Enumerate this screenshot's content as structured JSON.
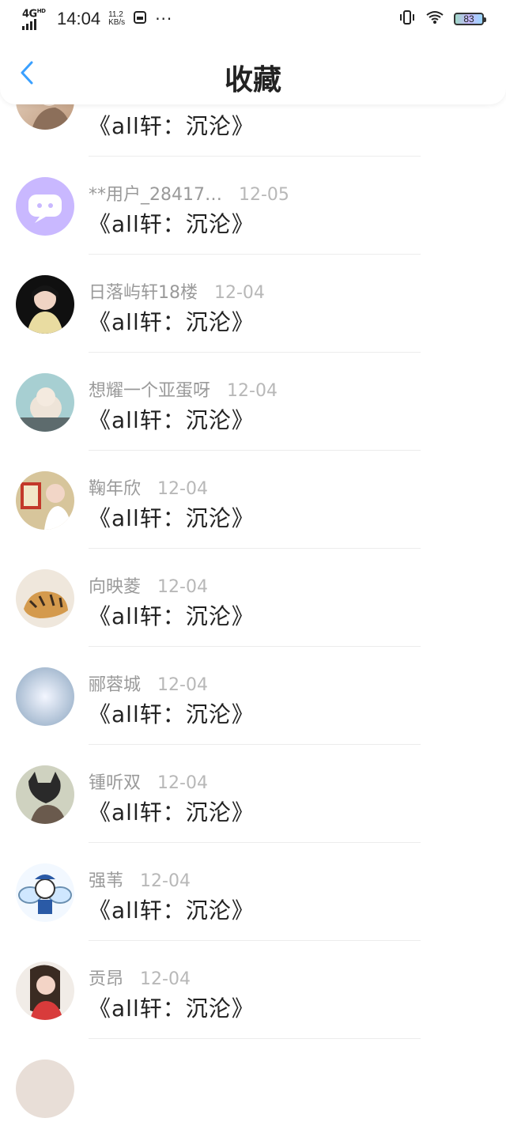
{
  "status_bar": {
    "network": "4G",
    "network_sup": "HD",
    "time": "14:04",
    "speed_value": "11.2",
    "speed_unit": "KB/s",
    "more": "···",
    "battery": "83"
  },
  "header": {
    "title": "收藏"
  },
  "list": {
    "items": [
      {
        "user": "",
        "time": "",
        "work": "《all轩：沉沦》"
      },
      {
        "user": "**用户_28417…",
        "time": "12-05",
        "work": "《all轩：沉沦》"
      },
      {
        "user": "日落屿轩18楼",
        "time": "12-04",
        "work": "《all轩：沉沦》"
      },
      {
        "user": "想耀一个亚蛋呀",
        "time": "12-04",
        "work": "《all轩：沉沦》"
      },
      {
        "user": "鞠年欣",
        "time": "12-04",
        "work": "《all轩：沉沦》"
      },
      {
        "user": "向映菱",
        "time": "12-04",
        "work": "《all轩：沉沦》"
      },
      {
        "user": "郦蓉城",
        "time": "12-04",
        "work": "《all轩：沉沦》"
      },
      {
        "user": "锺听双",
        "time": "12-04",
        "work": "《all轩：沉沦》"
      },
      {
        "user": "强苇",
        "time": "12-04",
        "work": "《all轩：沉沦》"
      },
      {
        "user": "贡昂",
        "time": "12-04",
        "work": "《all轩：沉沦》"
      },
      {
        "user": "",
        "time": "",
        "work": ""
      }
    ]
  },
  "colors": {
    "accent": "#3aa0ff",
    "text": "#222222",
    "meta": "#9a9a9a"
  },
  "icons": {
    "back": "chevron-left-icon",
    "wifi": "wifi-icon",
    "vibrate": "vibrate-icon",
    "sim": "sim-card-icon",
    "battery": "battery-icon"
  }
}
